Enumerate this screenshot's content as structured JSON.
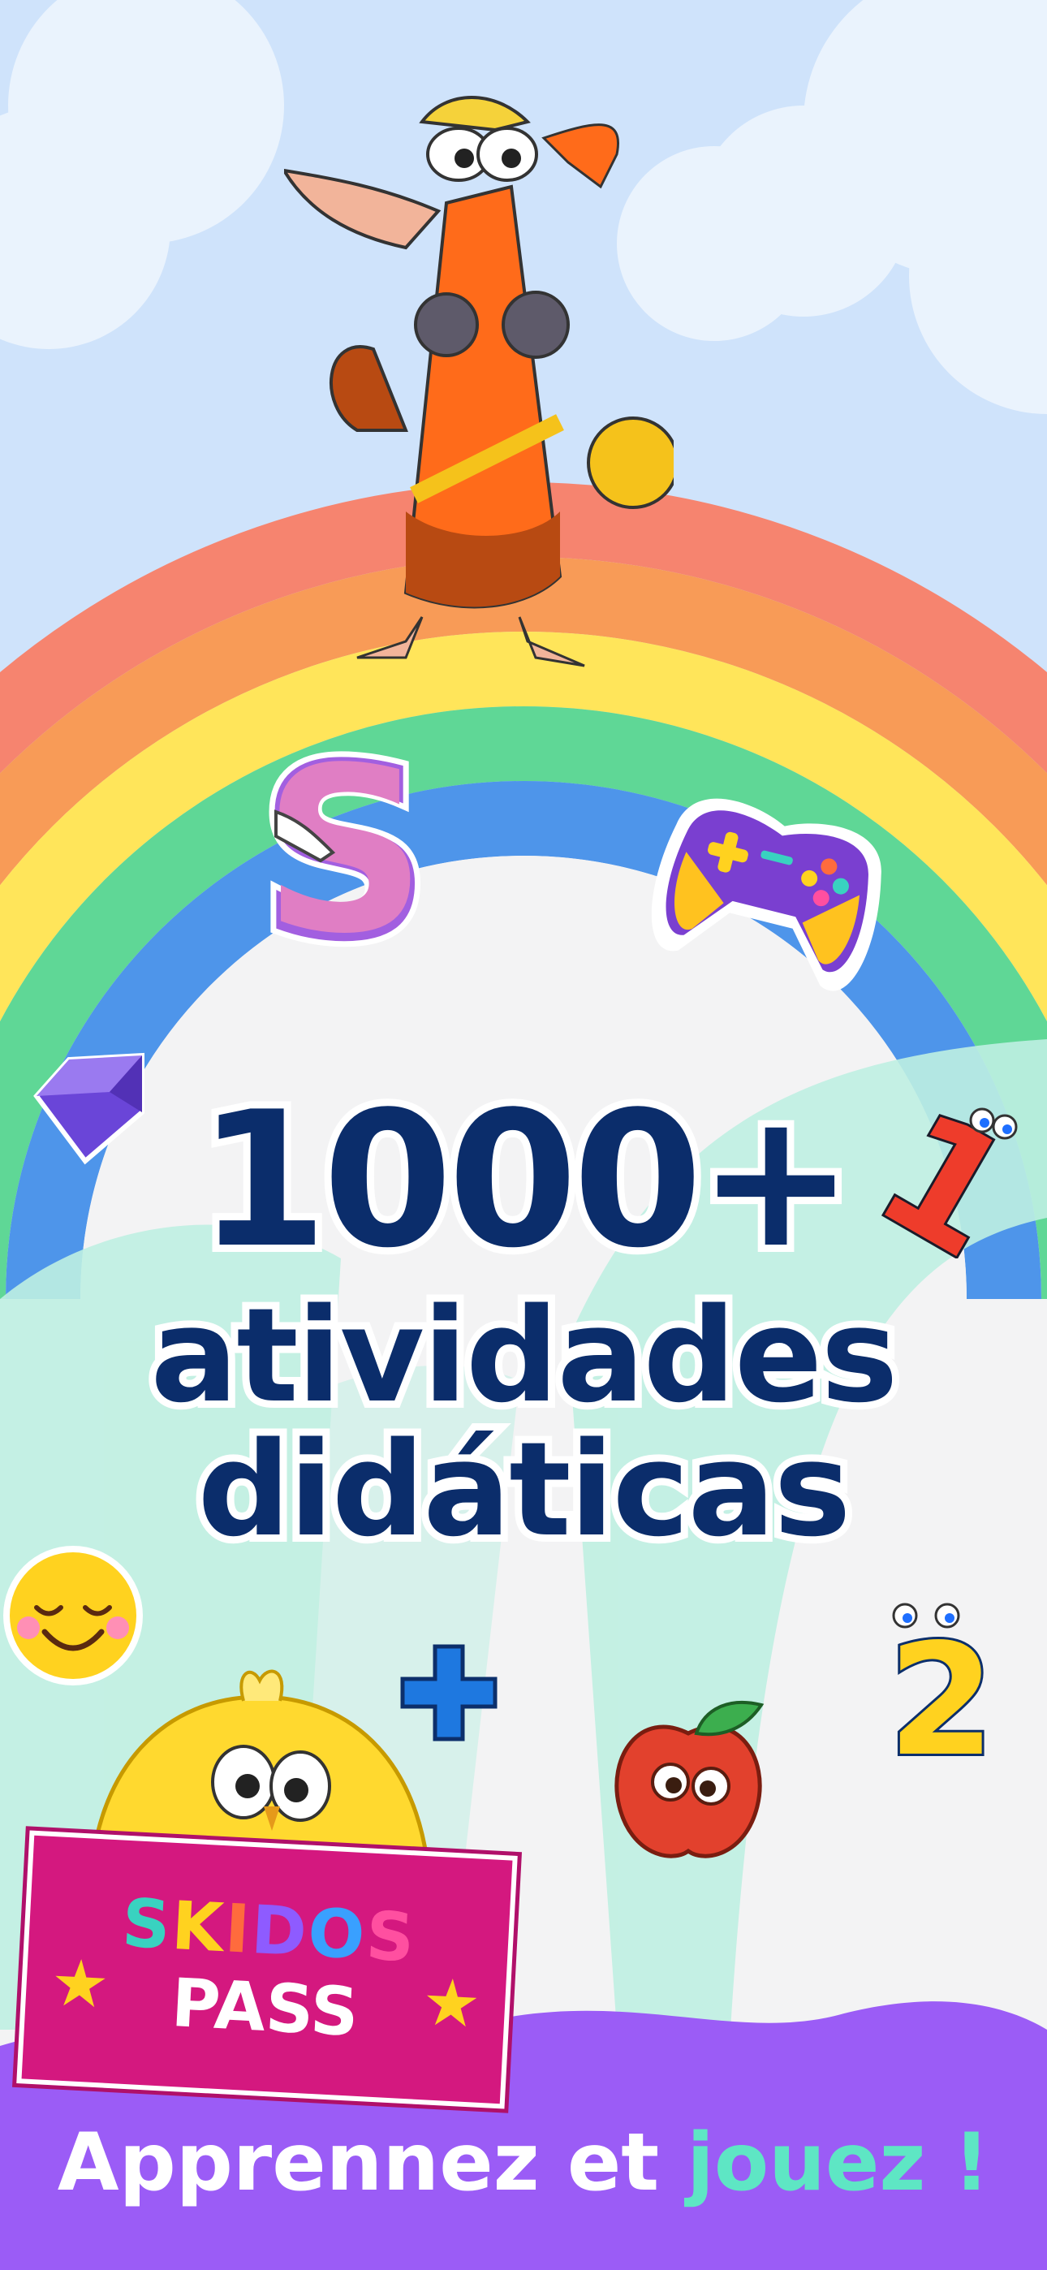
{
  "headline": {
    "count": "1000+",
    "line1": "atividades",
    "line2": "didáticas"
  },
  "badge": {
    "brand_letters": [
      "S",
      "K",
      "I",
      "D",
      "O",
      "S"
    ],
    "brand_colors": [
      "#39d2c0",
      "#ffd21f",
      "#ff6b3d",
      "#8e5bff",
      "#39a0ff",
      "#ff4fa0"
    ],
    "subtitle": "PASS"
  },
  "tagline": {
    "prefix": "Apprennez et",
    "accent": "jouez !"
  },
  "colors": {
    "sky": "#cfe3fb",
    "headline": "#0b2d6b",
    "bottom_band": "#9b5cf6",
    "badge": "#d4187f",
    "accent": "#5ee6c4"
  },
  "icons": [
    "pelican-mascot",
    "letter-s-tracing-icon",
    "gamepad-icon",
    "gem-icon",
    "number-one-icon",
    "smiley-icon",
    "plus-icon",
    "number-two-icon",
    "apple-icon",
    "chick-mascot",
    "star-icon"
  ]
}
